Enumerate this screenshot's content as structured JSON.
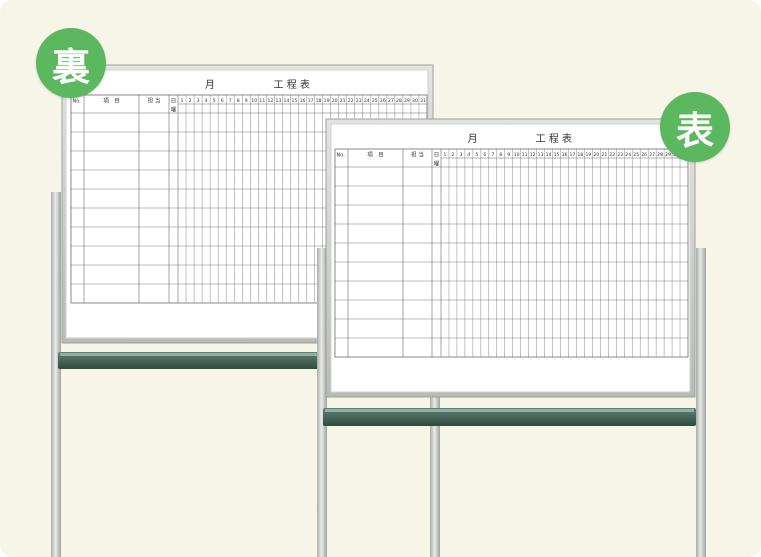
{
  "badges": {
    "back": "裏",
    "front": "表"
  },
  "board": {
    "title_month": "月",
    "title_main": "工 程 表",
    "header_no": "No.",
    "header_item": "項　目",
    "header_person": "担 当",
    "header_day": "日",
    "header_weekday": "曜",
    "days": [
      "1",
      "2",
      "3",
      "4",
      "5",
      "6",
      "7",
      "8",
      "9",
      "10",
      "11",
      "12",
      "13",
      "14",
      "15",
      "16",
      "17",
      "18",
      "19",
      "20",
      "21",
      "22",
      "23",
      "24",
      "25",
      "26",
      "27",
      "28",
      "29",
      "30",
      "31"
    ]
  },
  "colors": {
    "background": "#f7f5e8",
    "badge": "#5cb85f",
    "frame": "#c9cdc9",
    "grid": "#6b6b6b",
    "tray": "#4a6e5e"
  }
}
